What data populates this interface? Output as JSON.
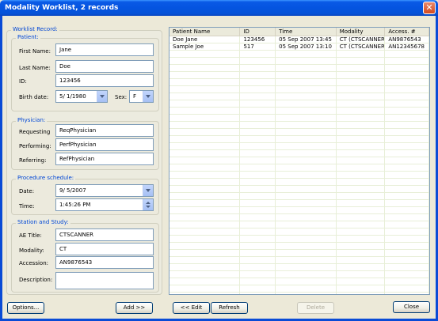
{
  "window": {
    "title": "Modality Worklist, 2 records",
    "close_glyph": "✕"
  },
  "record_group": {
    "title": "Worklist Record:"
  },
  "patient": {
    "title": "Patient:",
    "first_name_label": "First Name:",
    "first_name": "Jane",
    "last_name_label": "Last Name:",
    "last_name": "Doe",
    "id_label": "ID:",
    "id": "123456",
    "birth_label": "Birth date:",
    "birth_date": "5/ 1/1980",
    "sex_label": "Sex:",
    "sex": "F"
  },
  "physician": {
    "title": "Physician:",
    "requesting_label": "Requesting",
    "requesting": "ReqPhysician",
    "performing_label": "Performing:",
    "performing": "PerfPhysician",
    "referring_label": "Referring:",
    "referring": "RefPhysician"
  },
  "schedule": {
    "title": "Procedure schedule:",
    "date_label": "Date:",
    "date": "9/ 5/2007",
    "time_label": "Time:",
    "time": "1:45:26 PM"
  },
  "station": {
    "title": "Station and Study:",
    "ae_label": "AE Title:",
    "ae": "CTSCANNER",
    "modality_label": "Modality:",
    "modality": "CT",
    "accession_label": "Accession:",
    "accession": "AN9876543",
    "description_label": "Description:",
    "description": ""
  },
  "worklist": {
    "columns": [
      "Patient Name",
      "ID",
      "Time",
      "Modality",
      "Access. #"
    ],
    "rows": [
      [
        "Doe Jane",
        "123456",
        "05 Sep 2007 13:45",
        "CT (CTSCANNER)",
        "AN9876543"
      ],
      [
        "Sample Joe",
        "517",
        "05 Sep 2007 13:10",
        "CT (CTSCANNER)",
        "AN12345678"
      ]
    ]
  },
  "buttons": {
    "options": "Options...",
    "add": "Add >>",
    "edit": "<< Edit",
    "refresh": "Refresh",
    "delete": "Delete",
    "close": "Close"
  }
}
